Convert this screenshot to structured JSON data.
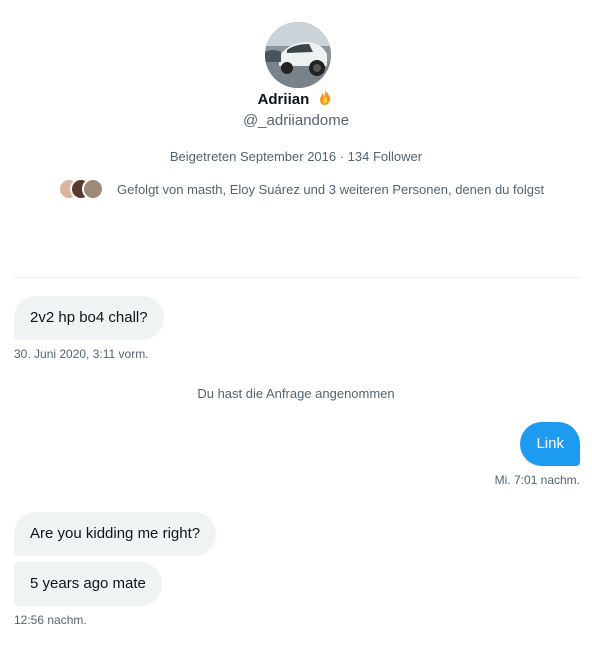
{
  "profile": {
    "name": "Adriian",
    "handle": "@_adriiandome",
    "meta": "Beigetreten September 2016 · 134 Follower",
    "followed_by": "Gefolgt von masth, Eloy Suárez und 3 weiteren Personen, denen du folgst",
    "name_emoji_icon": "fire-emoji-icon"
  },
  "conversation": {
    "messages": [
      {
        "text": "2v2 hp bo4 chall?",
        "direction": "in"
      },
      {
        "text": "30. Juni 2020, 3:11 vorm.",
        "kind": "timestamp"
      },
      {
        "text": "Du hast die Anfrage angenommen",
        "kind": "system"
      },
      {
        "text": "Link",
        "direction": "out"
      },
      {
        "text": "Mi. 7:01 nachm.",
        "kind": "timestamp"
      },
      {
        "text": "Are you kidding me right?",
        "direction": "in"
      },
      {
        "text": "5 years ago mate",
        "direction": "in"
      },
      {
        "text": "12:56 nachm.",
        "kind": "timestamp"
      }
    ]
  },
  "colors": {
    "outgoing_bubble": "#1d9bf0",
    "incoming_bubble": "#eff3f4",
    "secondary_text": "#536471"
  }
}
